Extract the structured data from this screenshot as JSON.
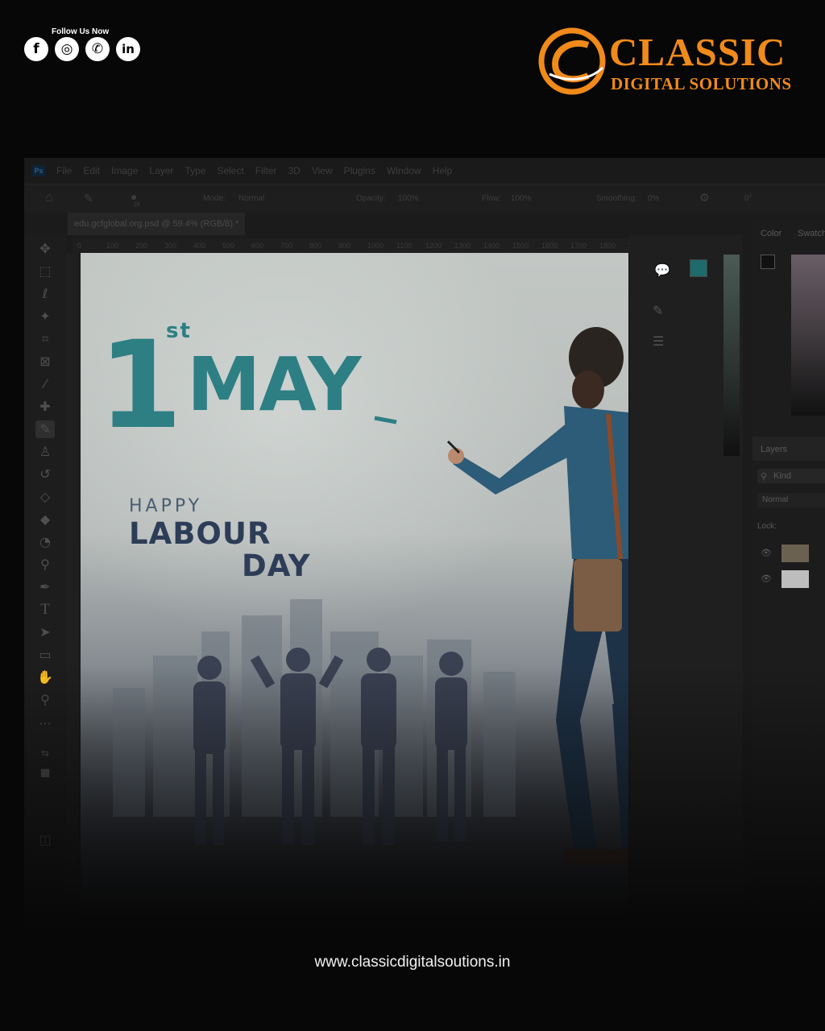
{
  "header": {
    "follow_label": "Follow Us Now",
    "social": [
      {
        "icon": "facebook-icon",
        "glyph": "f"
      },
      {
        "icon": "instagram-icon",
        "glyph": "◎"
      },
      {
        "icon": "whatsapp-icon",
        "glyph": "✆"
      },
      {
        "icon": "linkedin-icon",
        "glyph": "in"
      }
    ]
  },
  "logo": {
    "title": "CLASSIC",
    "subtitle": "DIGITAL SOLUTIONS",
    "color": "#f08a1a"
  },
  "photoshop": {
    "app_badge": "Ps",
    "menu": [
      "File",
      "Edit",
      "Image",
      "Layer",
      "Type",
      "Select",
      "Filter",
      "3D",
      "View",
      "Plugins",
      "Window",
      "Help"
    ],
    "options": {
      "mode_label": "Mode:",
      "mode_value": "Normal",
      "opacity_label": "Opacity:",
      "opacity_value": "100%",
      "flow_label": "Flow:",
      "flow_value": "100%",
      "smoothing_label": "Smoothing:",
      "smoothing_value": "0%",
      "angle_value": "0°",
      "brush_size": "26"
    },
    "doc_tab": "edu.gcfglobal.org.psd @ 59.4% (RGB/8) *",
    "ruler_ticks": [
      "0",
      "100",
      "200",
      "300",
      "400",
      "500",
      "600",
      "700",
      "800",
      "900",
      "1000",
      "1100",
      "1200",
      "1300",
      "1400",
      "1500",
      "1600",
      "1700",
      "1800",
      "1900"
    ],
    "panels": {
      "color_tab": "Color",
      "swatches_tab": "Swatch",
      "layers_tab": "Layers",
      "kind_label": "Kind",
      "blend_mode": "Normal",
      "lock_label": "Lock:"
    }
  },
  "artwork": {
    "day_number": "1",
    "ordinal": "st",
    "month": "MAY",
    "line1": "HAPPY",
    "line2": "LABOUR",
    "line3": "DAY",
    "accent_color": "#2d7f84"
  },
  "footer": {
    "website": "www.classicdigitalsoutions.in"
  }
}
